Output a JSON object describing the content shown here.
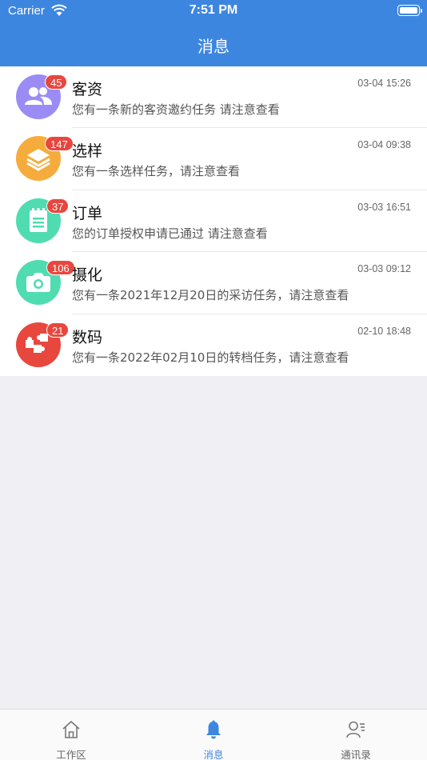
{
  "status_bar": {
    "carrier": "Carrier",
    "time": "7:51 PM"
  },
  "nav": {
    "title": "消息"
  },
  "messages": [
    {
      "title": "客资",
      "time": "03-04 15:26",
      "desc": "您有一条新的客资邀约任务 请注意查看",
      "badge": "45",
      "color": "#9b8cf5",
      "icon": "users-icon"
    },
    {
      "title": "选样",
      "time": "03-04 09:38",
      "desc": "您有一条选样任务，请注意查看",
      "badge": "147",
      "color": "#f5ac3c",
      "icon": "layers-icon"
    },
    {
      "title": "订单",
      "time": "03-03 16:51",
      "desc": "您的订单授权申请已通过 请注意查看",
      "badge": "37",
      "color": "#4fdcb0",
      "icon": "notepad-icon"
    },
    {
      "title": "摄化",
      "time": "03-03 09:12",
      "desc": "您有一条2021年12月20日的采访任务，请注意查看",
      "badge": "106",
      "color": "#4fdcb0",
      "icon": "camera-icon"
    },
    {
      "title": "数码",
      "time": "02-10 18:48",
      "desc": "您有一条2022年02月10日的转档任务，请注意查看",
      "badge": "21",
      "color": "#e8473e",
      "icon": "puzzle-icon"
    }
  ],
  "tabbar": {
    "tabs": [
      {
        "label": "工作区",
        "icon": "home-icon",
        "active": false
      },
      {
        "label": "消息",
        "icon": "bell-icon",
        "active": true
      },
      {
        "label": "通讯录",
        "icon": "contacts-icon",
        "active": false
      }
    ]
  }
}
